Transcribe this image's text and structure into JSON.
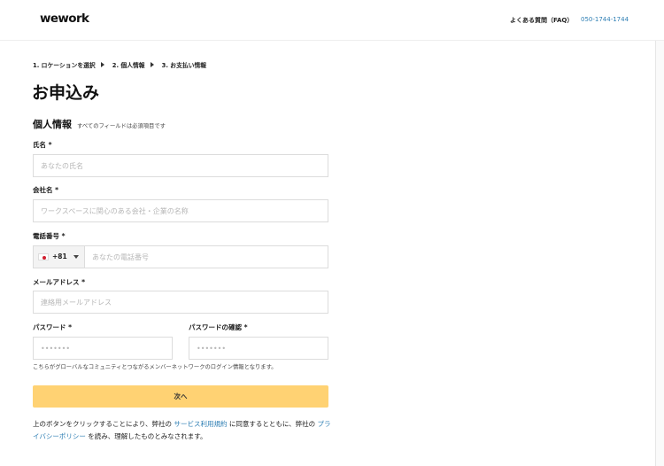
{
  "header": {
    "logo": "wework",
    "faq": "よくある質問（FAQ）",
    "phone": "050-1744-1744"
  },
  "breadcrumb": {
    "step1": "1. ロケーションを選択",
    "step2": "2. 個人情報",
    "step3": "3. お支払い情報"
  },
  "page": {
    "title": "お申込み"
  },
  "section": {
    "title": "個人情報",
    "subtitle": "すべてのフィールドは必須項目です"
  },
  "form": {
    "name": {
      "label": "氏名 *",
      "placeholder": "あなたの氏名",
      "value": ""
    },
    "company": {
      "label": "会社名 *",
      "placeholder": "ワークスペースに関心のある会社・企業の名称",
      "value": ""
    },
    "phone": {
      "label": "電話番号 *",
      "country_code": "+81",
      "flag_icon": "japan-flag-icon",
      "placeholder": "あなたの電話番号",
      "value": ""
    },
    "email": {
      "label": "メールアドレス *",
      "placeholder": "連絡用メールアドレス",
      "value": ""
    },
    "password": {
      "label": "パスワード *",
      "placeholder": "•••••••",
      "value": ""
    },
    "password_confirm": {
      "label": "パスワードの確認 *",
      "placeholder": "•••••••",
      "value": ""
    },
    "hint": "こちらがグローバルなコミュニティとつながるメンバーネットワークのログイン情報となります。"
  },
  "actions": {
    "next_label": "次へ",
    "next_color": "#ffd273"
  },
  "terms": {
    "part1": "上のボタンをクリックすることにより、弊社の",
    "link1": "サービス利用規約",
    "part2": "に同意するとともに、弊社の",
    "link2": "プライバシーポリシー",
    "part3": "を読み、理解したものとみなされます。"
  },
  "colors": {
    "accent": "#ffd273",
    "link": "#2f7fb4"
  }
}
